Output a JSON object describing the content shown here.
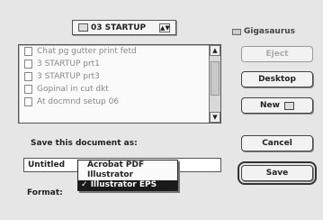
{
  "folder_popup": {
    "label": "03 STARTUP",
    "arrow": "▲▼"
  },
  "file_list": {
    "items": [
      "Chat pg gutter print fetd",
      "3 STARTUP prt1",
      "3 STARTUP prt3",
      "Gopinal in cut dkt",
      "At docmnd setup 06"
    ]
  },
  "disk": {
    "label": "Gigasaurus"
  },
  "buttons": {
    "eject": "Eject",
    "desktop": "Desktop",
    "new": "New",
    "cancel": "Cancel",
    "save": "Save"
  },
  "save_label": "Save this document as:",
  "name_field": {
    "value": "Untitled"
  },
  "format": {
    "label": "Format:",
    "options": [
      "Acrobat PDF",
      "Illustrator",
      "Illustrator EPS"
    ],
    "selected_index": 2,
    "check": "✓"
  },
  "scroll": {
    "up": "▲",
    "down": "▼"
  }
}
